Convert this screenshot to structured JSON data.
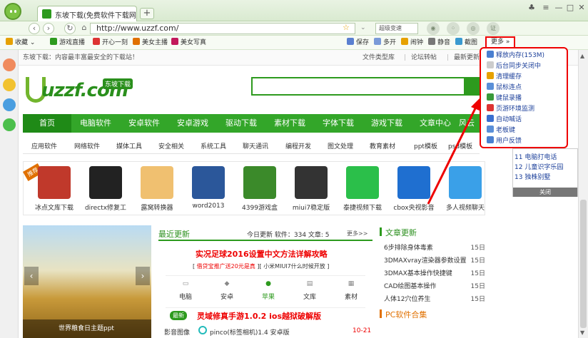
{
  "browser": {
    "tab_title": "东坡下载(免费软件下载网",
    "new_tab": "+",
    "url": "http://www.uzzf.com/",
    "search_placeholder": "超级变速",
    "toolbar_right": [
      "保存",
      "多开",
      "闹钟",
      "静音",
      "截图"
    ],
    "more_label": "更多",
    "badge": "证"
  },
  "bookmarks": [
    {
      "label": "收藏",
      "color": "#e6a100"
    },
    {
      "label": "游戏直播",
      "color": "#2d9a1e"
    },
    {
      "label": "开心一刻",
      "color": "#d33"
    },
    {
      "label": "美女主播",
      "color": "#e07000"
    },
    {
      "label": "美女写真",
      "color": "#c2185b"
    }
  ],
  "site": {
    "welcome": "东坡下载：内容最丰富最安全的下载站！",
    "top_links": [
      "文件类型库",
      "论坛转帖",
      "最新更新"
    ],
    "logo_text": "uzzf.com",
    "logo_tag": "东坡下载",
    "main_nav": [
      "首页",
      "电脑软件",
      "安卓软件",
      "安卓游戏",
      "驱动下载",
      "素材下载",
      "字体下载",
      "游戏下载",
      "文章中心",
      "风云"
    ],
    "sub_nav": [
      "应用软件",
      "网络软件",
      "媒体工具",
      "安全相关",
      "系统工具",
      "聊天通讯",
      "编程开发",
      "图文处理",
      "教育素材",
      "ppt模板",
      "psd模板"
    ],
    "apps": [
      {
        "name": "冰点文库下载",
        "color": "#c0392b"
      },
      {
        "name": "directx修复工",
        "color": "#222"
      },
      {
        "name": "露窝转换器",
        "color": "#f0c070"
      },
      {
        "name": "word2013",
        "color": "#2b579a"
      },
      {
        "name": "4399游戏盒",
        "color": "#3b8a2a"
      },
      {
        "name": "miui7稳定版",
        "color": "#333"
      },
      {
        "name": "泰捷视频下载",
        "color": "#2bbf4a"
      },
      {
        "name": "cbox央视影音",
        "color": "#1f6fd0"
      },
      {
        "name": "多人视频聊天",
        "color": "#3aa0e8"
      }
    ],
    "app_badge": "推荐",
    "banner": {
      "caption": "世界粮食日主题ppt",
      "prev": "‹",
      "next": "›"
    },
    "news": {
      "title": "最近更新",
      "stats": "今日更新 软件：334 文章: 5",
      "more": "更多>>",
      "headline": "实况足球2016设置中文方法详解攻略",
      "sub1": "借贷宝推广送20元是真",
      "sub2": "小米MIUI7什么时候开放",
      "cats": [
        "电脑",
        "安卓",
        "苹果",
        "文库",
        "素材"
      ],
      "new_badge": "最新",
      "item1": "灵域修真手游1.0.2 ios越狱破解版",
      "item2_cat": "影音图像",
      "item2": "pinco(标签相机)1.4 安卓版",
      "item2_date": "10-21"
    },
    "articles": {
      "title": "文章更新",
      "items": [
        {
          "t": "6步排除身体毒素",
          "d": "15日"
        },
        {
          "t": "3DMAXvray渲染器参数设置",
          "d": "15日"
        },
        {
          "t": "3DMAX基本操作快捷键",
          "d": "15日"
        },
        {
          "t": "CAD绘图基本操作",
          "d": "15日"
        },
        {
          "t": "人体12穴位养生",
          "d": "15日"
        }
      ],
      "pc_title": "PC软件合集"
    }
  },
  "more_menu": [
    "释放内存(153M)",
    "后台同步关闭中",
    "清理缓存",
    "鼠标连点",
    "键鼠录播",
    "页游环境监测",
    "自动喊话",
    "老板键",
    "用户反馈"
  ],
  "popup": {
    "items": [
      "11 电脑打电话",
      "12 儿童识字乐园",
      "13 独株别墅"
    ],
    "close": "关闭"
  }
}
